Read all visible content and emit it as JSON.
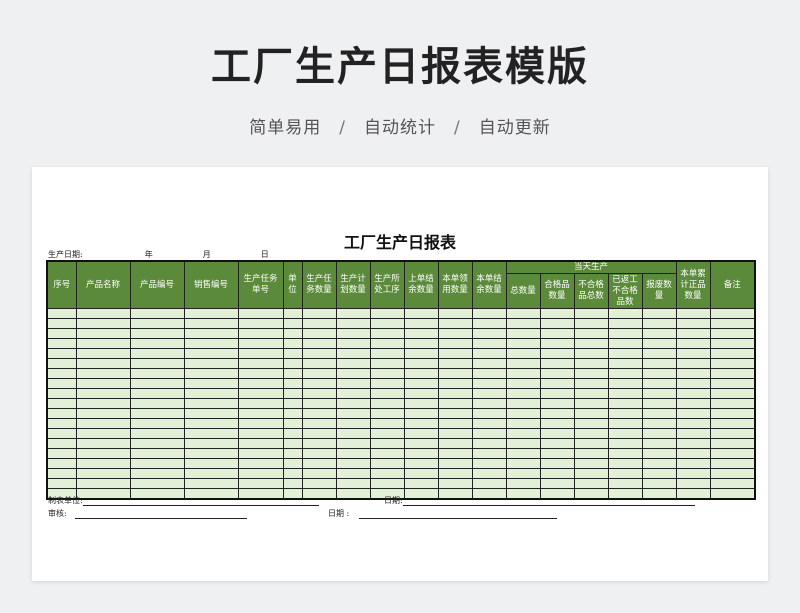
{
  "hero": {
    "title": "工厂生产日报表模版",
    "tags": [
      "简单易用",
      "自动统计",
      "自动更新"
    ],
    "separator": "/"
  },
  "sheet": {
    "title": "工厂生产日报表",
    "date_label": "生产日期:",
    "year": "年",
    "month": "月",
    "day": "日",
    "headers": {
      "c1": "序号",
      "c2": "产品名称",
      "c3": "产品编号",
      "c4": "销售编号",
      "c5": "生产任务单号",
      "c6": "单位",
      "c7": "生产任务数量",
      "c8": "生产计划数量",
      "c9": "生产所处工序",
      "c10": "上单结余数量",
      "c11": "本单领用数量",
      "c12": "本单结余数量",
      "group": "当天生产",
      "g1": "总数量",
      "g2": "合格品数量",
      "g3": "不合格品总数",
      "g4": "已返工不合格品数",
      "g5": "报废数量",
      "c18": "本单累计正品数量",
      "c19": "备注"
    },
    "row_count": 19,
    "footer": {
      "maker_label": "制表单位:",
      "date1_label": "日期:",
      "reviewer_label": "审核:",
      "date2_label": "日期 :"
    }
  }
}
